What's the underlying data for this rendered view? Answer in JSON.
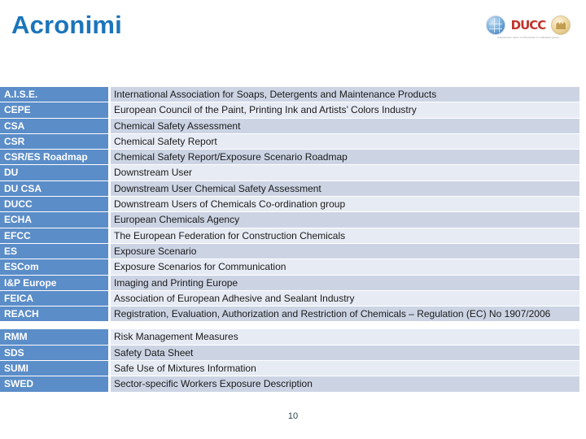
{
  "header": {
    "title": "Acronimi"
  },
  "logo": {
    "globe_icon": "globe-icon",
    "wordmark": "DUCC",
    "badge_icon": "gold-badge-icon",
    "tagline": "downstream users of chemicals co-ordination group"
  },
  "colors": {
    "title_blue": "#1b75ba",
    "term_cell_blue": "#5b8dc8",
    "row_alt_dark": "#ccd4e4",
    "row_alt_light": "#e7ebf4",
    "logo_red": "#c1342c",
    "text_dark": "#1a1a1a"
  },
  "table": {
    "rows": [
      {
        "term": "A.I.S.E.",
        "definition": "International Association for Soaps, Detergents and Maintenance Products"
      },
      {
        "term": "CEPE",
        "definition": "European Council of the Paint, Printing Ink and Artists’ Colors Industry"
      },
      {
        "term": "CSA",
        "definition": "Chemical Safety Assessment"
      },
      {
        "term": "CSR",
        "definition": "Chemical Safety Report"
      },
      {
        "term": "CSR/ES Roadmap",
        "definition": "Chemical Safety Report/Exposure Scenario Roadmap"
      },
      {
        "term": "DU",
        "definition": "Downstream User"
      },
      {
        "term": "DU CSA",
        "definition": "Downstream User Chemical Safety Assessment"
      },
      {
        "term": "DUCC",
        "definition": "Downstream Users of Chemicals Co-ordination group"
      },
      {
        "term": "ECHA",
        "definition": "European Chemicals Agency"
      },
      {
        "term": "EFCC",
        "definition": "The European Federation for Construction Chemicals"
      },
      {
        "term": "ES",
        "definition": "Exposure Scenario"
      },
      {
        "term": "ESCom",
        "definition": "Exposure Scenarios for Communication"
      },
      {
        "term": "I&P Europe",
        "definition": "Imaging and Printing Europe"
      },
      {
        "term": "FEICA",
        "definition": "Association of European Adhesive and Sealant Industry"
      },
      {
        "term": "REACH",
        "definition": "Registration, Evaluation, Authorization and Restriction of Chemicals – Regulation (EC) No 1907/2006",
        "tall": true
      },
      {
        "term": "RMM",
        "definition": "Risk Management Measures"
      },
      {
        "term": "SDS",
        "definition": "Safety Data Sheet"
      },
      {
        "term": "SUMI",
        "definition": "Safe Use of Mixtures Information"
      },
      {
        "term": "SWED",
        "definition": "Sector-specific Workers Exposure Description"
      }
    ]
  },
  "footer": {
    "page_number": "10"
  }
}
